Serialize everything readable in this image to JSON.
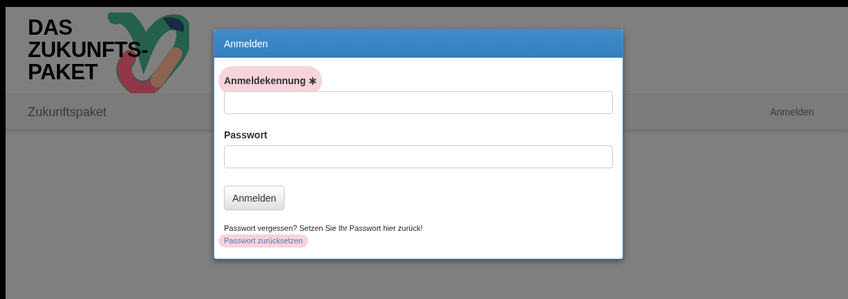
{
  "logo": {
    "lines": [
      "DAS",
      "ZUKUNFTS-",
      "PAKET"
    ]
  },
  "navbar": {
    "brand": "Zukunftspaket",
    "link": "Anmelden"
  },
  "modal": {
    "title": "Anmelden",
    "fields": [
      {
        "label": "Anmeldekennung",
        "required": true,
        "highlighted": true
      },
      {
        "label": "Passwort",
        "required": false,
        "highlighted": false
      }
    ],
    "submit": "Anmelden",
    "hint": "Passwort vergessen? Setzen Sie Ihr Passwort hier zurück!",
    "reset_link": {
      "label": "Passwort zurücksetzen",
      "highlighted": true
    }
  }
}
